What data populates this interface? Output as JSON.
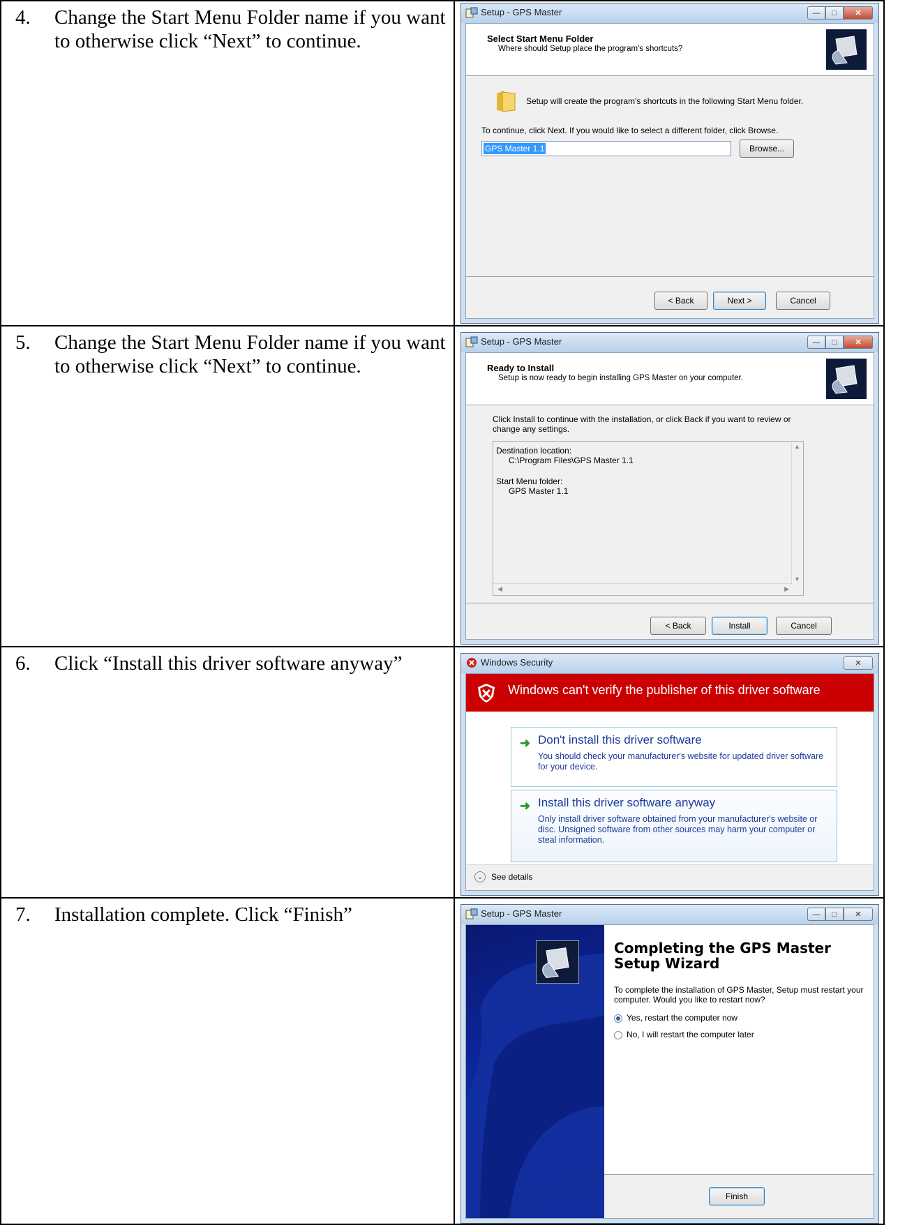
{
  "steps": [
    {
      "number": "4.",
      "text": "Change the Start Menu Folder name if you want to otherwise click “Next” to continue."
    },
    {
      "number": "5.",
      "text": "Change the Start Menu Folder name if you want to otherwise click “Next” to continue."
    },
    {
      "number": "6.",
      "text": "Click “Install this driver software anyway”"
    },
    {
      "number": "7.",
      "text": "Installation complete. Click “Finish”"
    }
  ],
  "win1": {
    "title": "Setup - GPS Master",
    "heading": "Select Start Menu Folder",
    "subheading": "Where should Setup place the program's shortcuts?",
    "info": "Setup will create the program's shortcuts in the following Start Menu folder.",
    "instruction": "To continue, click Next. If you would like to select a different folder, click Browse.",
    "folder_value": "GPS Master 1.1",
    "browse_label": "Browse...",
    "back_label": "< Back",
    "next_label": "Next >",
    "cancel_label": "Cancel"
  },
  "win2": {
    "title": "Setup - GPS Master",
    "heading": "Ready to Install",
    "subheading": "Setup is now ready to begin installing GPS Master on your computer.",
    "instruction_line1": "Click Install to continue with the installation, or click Back if you want to review or",
    "instruction_line2": "change any settings.",
    "dest_label": "Destination location:",
    "dest_value": "C:\\Program Files\\GPS Master 1.1",
    "menu_label": "Start Menu folder:",
    "menu_value": "GPS Master 1.1",
    "back_label": "< Back",
    "install_label": "Install",
    "cancel_label": "Cancel"
  },
  "win3": {
    "title": "Windows Security",
    "banner": "Windows can't verify the publisher of this driver software",
    "option1_title": "Don't install this driver software",
    "option1_desc": "You should check your manufacturer's website for updated driver software for your device.",
    "option2_title": "Install this driver software anyway",
    "option2_desc": "Only install driver software obtained from your manufacturer's website or disc. Unsigned software from other sources may harm your computer or steal information.",
    "details_label": "See details"
  },
  "win4": {
    "title": "Setup - GPS Master",
    "heading": "Completing the GPS Master Setup Wizard",
    "body": "To complete the installation of GPS Master, Setup must restart your computer. Would you like to restart now?",
    "radio_yes": "Yes, restart the computer now",
    "radio_no": "No, I will restart the computer later",
    "finish_label": "Finish"
  },
  "colors": {
    "security_red": "#cc0000",
    "wizard_blue": "#0d2aa8",
    "link_blue": "#1a3a9c"
  },
  "icons": [
    "setup-app-icon",
    "folder-icon",
    "shield-error-icon",
    "green-arrow-icon",
    "chevron-down-icon",
    "setup-computer-logo"
  ]
}
